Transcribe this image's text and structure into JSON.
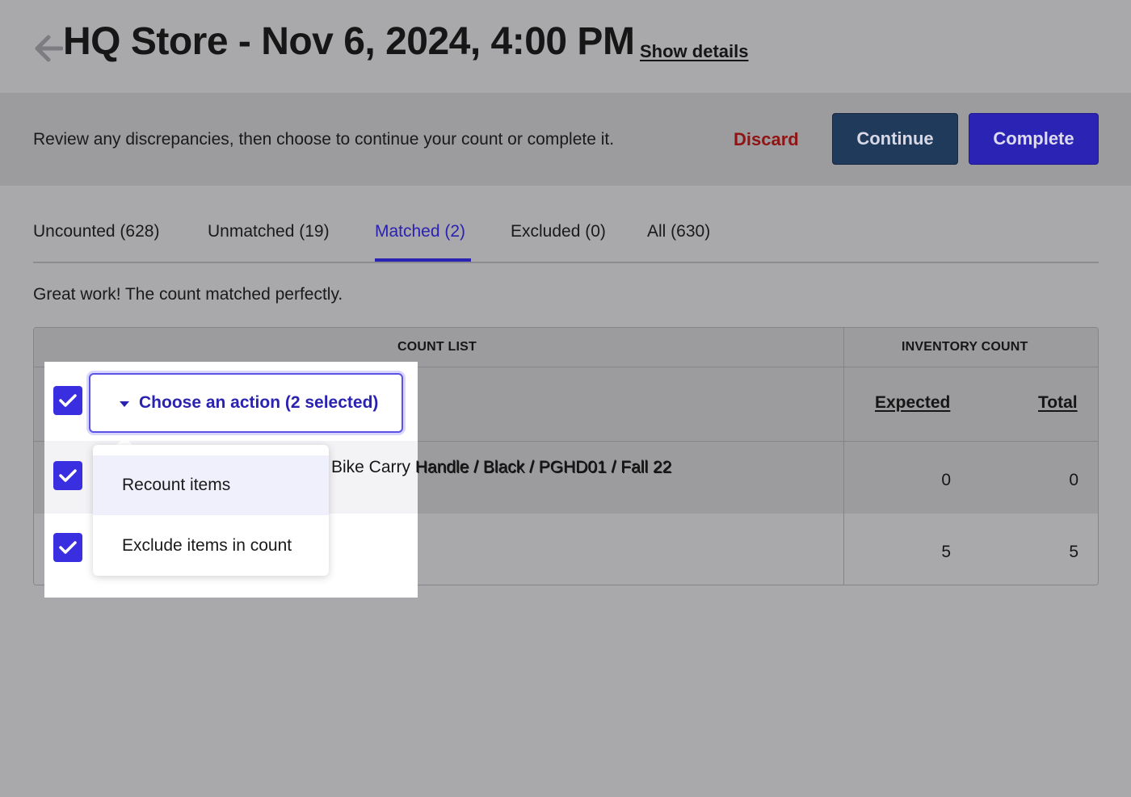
{
  "header": {
    "title": "HQ Store - Nov 6, 2024, 4:00 PM",
    "show_details": "Show details"
  },
  "review_bar": {
    "message": "Review any discrepancies, then choose to continue your count or complete it.",
    "discard": "Discard",
    "continue": "Continue",
    "complete": "Complete"
  },
  "tabs": [
    {
      "label": "Uncounted (628)"
    },
    {
      "label": "Unmatched (19)"
    },
    {
      "label": "Matched (2)",
      "active": true
    },
    {
      "label": "Excluded (0)"
    },
    {
      "label": "All (630)"
    }
  ],
  "matched_message": "Great work! The count matched perfectly.",
  "table": {
    "headers": {
      "count_list": "COUNT LIST",
      "inventory_count": "INVENTORY COUNT"
    },
    "columns": {
      "expected": "Expected",
      "total": "Total"
    },
    "action_select": {
      "label": "Choose an action (2 selected)"
    },
    "menu": [
      "Recount items",
      "Exclude items in count"
    ],
    "rows": [
      {
        "name": "Bike Carry Handle / Black / PGHD01 / Fall 22",
        "expected": "0",
        "total": "0"
      },
      {
        "name": "",
        "expected": "5",
        "total": "5"
      }
    ]
  },
  "colors": {
    "accent": "#2a22b0",
    "checkbox": "#3a2fe0",
    "continue_bg": "#1f3a5a",
    "complete_bg": "#2b23b4",
    "discard": "#8f1414",
    "overlay": "#a9a8ab"
  }
}
